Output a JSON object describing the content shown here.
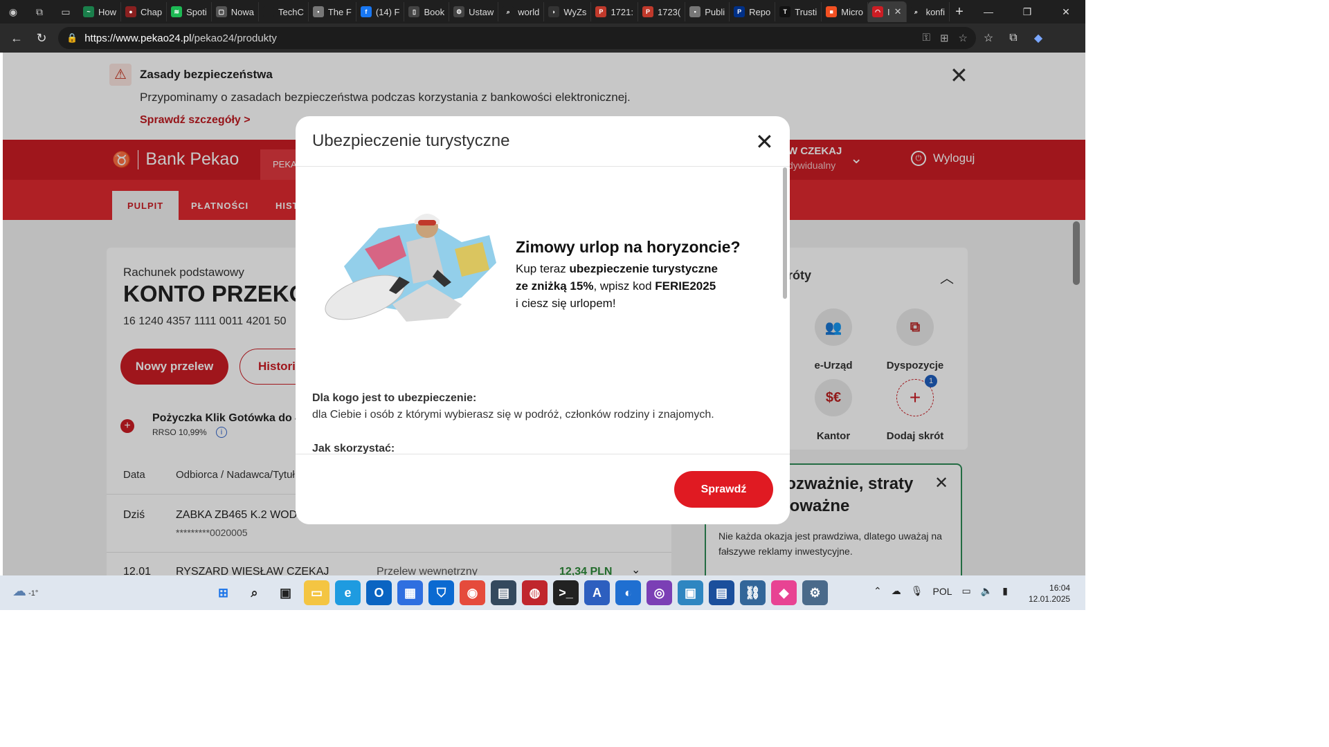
{
  "browser": {
    "tabs": [
      {
        "label": "How",
        "fav_color": "#1a7f4b",
        "fav_char": "~"
      },
      {
        "label": "Chap",
        "fav_color": "#8a2020",
        "fav_char": "●"
      },
      {
        "label": "Spoti",
        "fav_color": "#1db954",
        "fav_char": "≋"
      },
      {
        "label": "Nowa",
        "fav_color": "#555555",
        "fav_char": "▢"
      },
      {
        "label": "TechC",
        "fav_color": "#1f1f1f",
        "fav_char": ""
      },
      {
        "label": "The F",
        "fav_color": "#777777",
        "fav_char": "▪"
      },
      {
        "label": "(14) F",
        "fav_color": "#1877f2",
        "fav_char": "f"
      },
      {
        "label": "Book",
        "fav_color": "#444444",
        "fav_char": "▯"
      },
      {
        "label": "Ustaw",
        "fav_color": "#444444",
        "fav_char": "⚙"
      },
      {
        "label": "world",
        "fav_color": "#1f1f1f",
        "fav_char": "⌕"
      },
      {
        "label": "WyZs",
        "fav_color": "#333333",
        "fav_char": "◗"
      },
      {
        "label": "1721:",
        "fav_color": "#c0392b",
        "fav_char": "P"
      },
      {
        "label": "1723(",
        "fav_color": "#c0392b",
        "fav_char": "P"
      },
      {
        "label": "Publi",
        "fav_color": "#777777",
        "fav_char": "▪"
      },
      {
        "label": "Repo",
        "fav_color": "#003087",
        "fav_char": "P"
      },
      {
        "label": "Trusti",
        "fav_color": "#111111",
        "fav_char": "T"
      },
      {
        "label": "Micro",
        "fav_color": "#f25022",
        "fav_char": "■"
      },
      {
        "label": "I",
        "fav_color": "#cc1d24",
        "fav_char": "◠",
        "active": true
      },
      {
        "label": "konfi",
        "fav_color": "#1f1f1f",
        "fav_char": "⌕"
      }
    ],
    "url_host": "https://www.pekao24.pl",
    "url_path": "/pekao24/produkty"
  },
  "security_banner": {
    "title": "Zasady bezpieczeństwa",
    "text": "Przypominamy o zasadach bezpieczeństwa podczas korzystania z bankowości elektronicznej.",
    "link": "Sprawdź szczegóły >"
  },
  "header": {
    "brand": "Bank Pekao",
    "product_tab": "PEKA",
    "user_name": "W CZEKAJ",
    "user_sub": "dywidualny",
    "logout": "Wyloguj"
  },
  "nav": {
    "items": [
      "PULPIT",
      "PŁATNOŚCI",
      "HIST"
    ]
  },
  "account": {
    "label": "Rachunek podstawowy",
    "name": "KONTO PRZEKO",
    "number": "16 1240 4357 1111 0011 4201 50",
    "btn_transfer": "Nowy przelew",
    "btn_history": "Historia",
    "loan_title": "Pożyczka Klik Gotówka do 40",
    "loan_sub": "RRSO 10,99%",
    "col_date": "Data",
    "col_party": "Odbiorca / Nadawca/Tytuł",
    "rows": [
      {
        "date": "Dziś",
        "party": "ZABKA ZB465 K.2 WOD",
        "ref": "*********0020005",
        "type": "",
        "amount": ""
      },
      {
        "date": "12.01",
        "party": "RYSZARD WIESŁAW CZEKAJ",
        "ref": "",
        "type": "Przelew wewnętrzny",
        "amount": "12,34 PLN"
      }
    ]
  },
  "shortcuts": {
    "title": "róty",
    "items": [
      {
        "label": "e-Urząd",
        "icon": "people-icon",
        "glyph": "👥"
      },
      {
        "label": "Dyspozycje",
        "icon": "documents-icon",
        "glyph": "⧉"
      },
      {
        "label": "Kantor",
        "icon": "currency-icon",
        "glyph": "$€"
      },
      {
        "label": "Dodaj skrót",
        "icon": "plus-icon",
        "glyph": "+",
        "badge": "1"
      }
    ]
  },
  "warning_card": {
    "title": "rozważnie, straty\npoważne",
    "text": "Nie każda okazja jest prawdziwa, dlatego uważaj na fałszywe reklamy inwestycyjne."
  },
  "modal": {
    "title": "Ubezpieczenie turystyczne",
    "promo_heading": "Zimowy urlop na horyzoncie?",
    "promo_line1_pre": "Kup teraz ",
    "promo_line1_bold": "ubezpieczenie turystyczne",
    "promo_line2_bold": "ze zniżką 15%",
    "promo_line2_mid": ", wpisz kod ",
    "promo_line2_code": "FERIE2025",
    "promo_line3": "i ciesz się urlopem!",
    "q1_label": "Dla kogo jest to ubezpieczenie:",
    "q1_text": "dla Ciebie i osób z którymi wybierasz się w podróż, członków rodziny i znajomych.",
    "q2_label": "Jak skorzystać:",
    "button": "Sprawdź"
  },
  "taskbar": {
    "weather": "-1°",
    "lang": "POL",
    "time": "16:04",
    "date": "12.01.2025"
  }
}
